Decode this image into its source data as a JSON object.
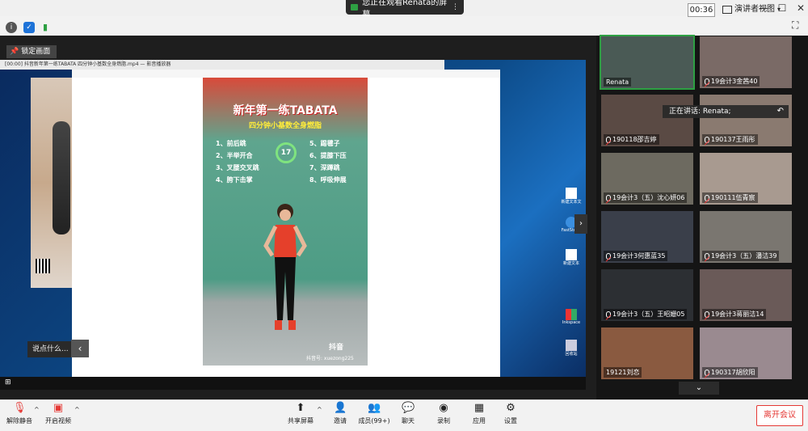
{
  "window": {
    "banner_text": "您正在观看Renata的屏幕",
    "minimize": "—",
    "maximize": "☐",
    "close": "✕"
  },
  "toolbar": {
    "timer": "00:36",
    "view_mode": "演讲者视图",
    "lock_screen": "锁定画面"
  },
  "shared_screen": {
    "strip_text": "[00:00] 抖音新年第一练TABATA 四分钟小基数全身燃脂.mp4 — 影音播放器",
    "video": {
      "title": "新年第一练TABATA",
      "subtitle": "四分钟小基数全身燃脂",
      "timer_label": "17",
      "exercises_left": [
        "1、前后跳",
        "2、半举开合",
        "3、叉腰交叉跳",
        "4、胯下击掌"
      ],
      "exercises_right": [
        "5、踢毽子",
        "6、提膝下压",
        "7、深蹲跳",
        "8、呼吸伸展"
      ],
      "watermark": "抖音",
      "account_id": "抖音号: xuezong225"
    },
    "desktop_icons": [
      "新建文本文",
      "FastStone",
      "新建文本",
      "Inkspace",
      "回收站"
    ],
    "chat_placeholder": "说点什么..."
  },
  "participants": [
    {
      "name": "Renata",
      "muted": false
    },
    {
      "name": "19会计3金茜40",
      "muted": true
    },
    {
      "name": "190118邵吉婷",
      "muted": true
    },
    {
      "name": "190137王雨彤",
      "muted": true
    },
    {
      "name": "19会计3（五）沈心妍06",
      "muted": true
    },
    {
      "name": "190111伍青宸",
      "muted": true
    },
    {
      "name": "19会计3何惠蓝35",
      "muted": true
    },
    {
      "name": "19会计3（五）潘洁39",
      "muted": true
    },
    {
      "name": "19会计3（五）王昭姗05",
      "muted": true
    },
    {
      "name": "19会计3蒋丽洁14",
      "muted": true
    },
    {
      "name": "19121刘恋",
      "muted": false
    },
    {
      "name": "190317胡欣阳",
      "muted": true
    }
  ],
  "speaking": "正在讲话: Renata;",
  "bottom_bar": {
    "unmute": "解除静音",
    "start_video": "开启视频",
    "share_screen": "共享屏幕",
    "invite": "邀请",
    "members": "成员(99+)",
    "chat": "聊天",
    "record": "录制",
    "apps": "应用",
    "settings": "设置",
    "leave": "离开会议"
  },
  "colors": {
    "accent_green": "#2ea043",
    "leave_red": "#e53935",
    "mute_red": "#e53935"
  }
}
